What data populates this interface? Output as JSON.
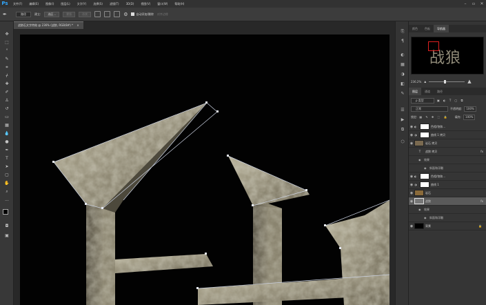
{
  "menubar": {
    "logo": "Ps",
    "items": [
      "文件(F)",
      "编辑(E)",
      "图像(I)",
      "图层(L)",
      "文字(Y)",
      "选择(S)",
      "滤镜(T)",
      "3D(D)",
      "视图(V)",
      "窗口(W)",
      "帮助(H)"
    ],
    "window_controls": [
      "–",
      "▫",
      "✕"
    ]
  },
  "options": {
    "mode_select": "路径",
    "make_label": "建立:",
    "selection_btn": "选区...",
    "mask_btn": "蒙版",
    "shape_btn": "形状",
    "auto_label": "自动添加/删除",
    "align_label": "对齐边缘"
  },
  "document": {
    "tab_label": "战狼石文字特效 @ 236% (战狼, RGB/8#) *",
    "tab_close": "×"
  },
  "panels": {
    "top_tabs": [
      "颜色",
      "色板",
      "导航器"
    ],
    "nav_zoom": "236.2%",
    "nav_thumb_text": "战狼",
    "layers_tabs": [
      "图层",
      "通道",
      "路径"
    ],
    "kind_filter": "ρ 类型",
    "blend_mode": "正常",
    "opacity_label": "不透明度:",
    "opacity_value": "100%",
    "lock_label": "锁定:",
    "fill_label": "填充:",
    "fill_value": "100%",
    "fx": "fx"
  },
  "layers": [
    {
      "name": "色相/饱和...",
      "type": "adjust"
    },
    {
      "name": "曲线 1 拷贝",
      "type": "adjust"
    },
    {
      "name": "岩石 拷贝",
      "type": "texture"
    },
    {
      "name": "战狼 拷贝",
      "type": "text"
    },
    {
      "name": "效果",
      "type": "sub"
    },
    {
      "name": "斜面和浮雕",
      "type": "sub"
    },
    {
      "name": "色相/饱和...",
      "type": "adjust"
    },
    {
      "name": "曲线 1",
      "type": "adjust"
    },
    {
      "name": "岩石",
      "type": "texture"
    },
    {
      "name": "战狼",
      "type": "text",
      "selected": true
    },
    {
      "name": "效果",
      "type": "sub"
    },
    {
      "name": "斜面和浮雕",
      "type": "sub"
    },
    {
      "name": "背景",
      "type": "bg"
    }
  ],
  "icons": [
    "pen-tool-icon",
    "move-tool-icon",
    "eye-icon",
    "lock-icon",
    "link-icon"
  ],
  "colors": {
    "accent": "#31a8ff",
    "stone_light": "#a9a28a",
    "stone_dark": "#4a463b"
  }
}
